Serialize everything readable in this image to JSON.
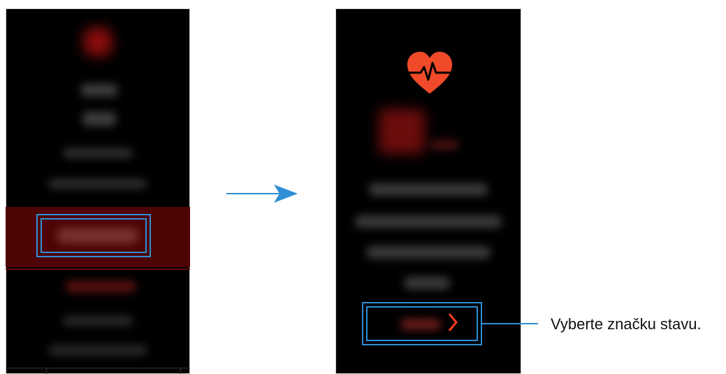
{
  "callout": {
    "text": "Vyberte značku stavu."
  },
  "icons": {
    "heart": "heart-pulse-icon",
    "arrow": "arrow-right-icon",
    "chevron": "chevron-right-icon"
  },
  "colors": {
    "accent": "#2f8fd6",
    "heart": "#f04a2a",
    "red_band": "#5a0606",
    "chevron": "#ff3b1f"
  }
}
